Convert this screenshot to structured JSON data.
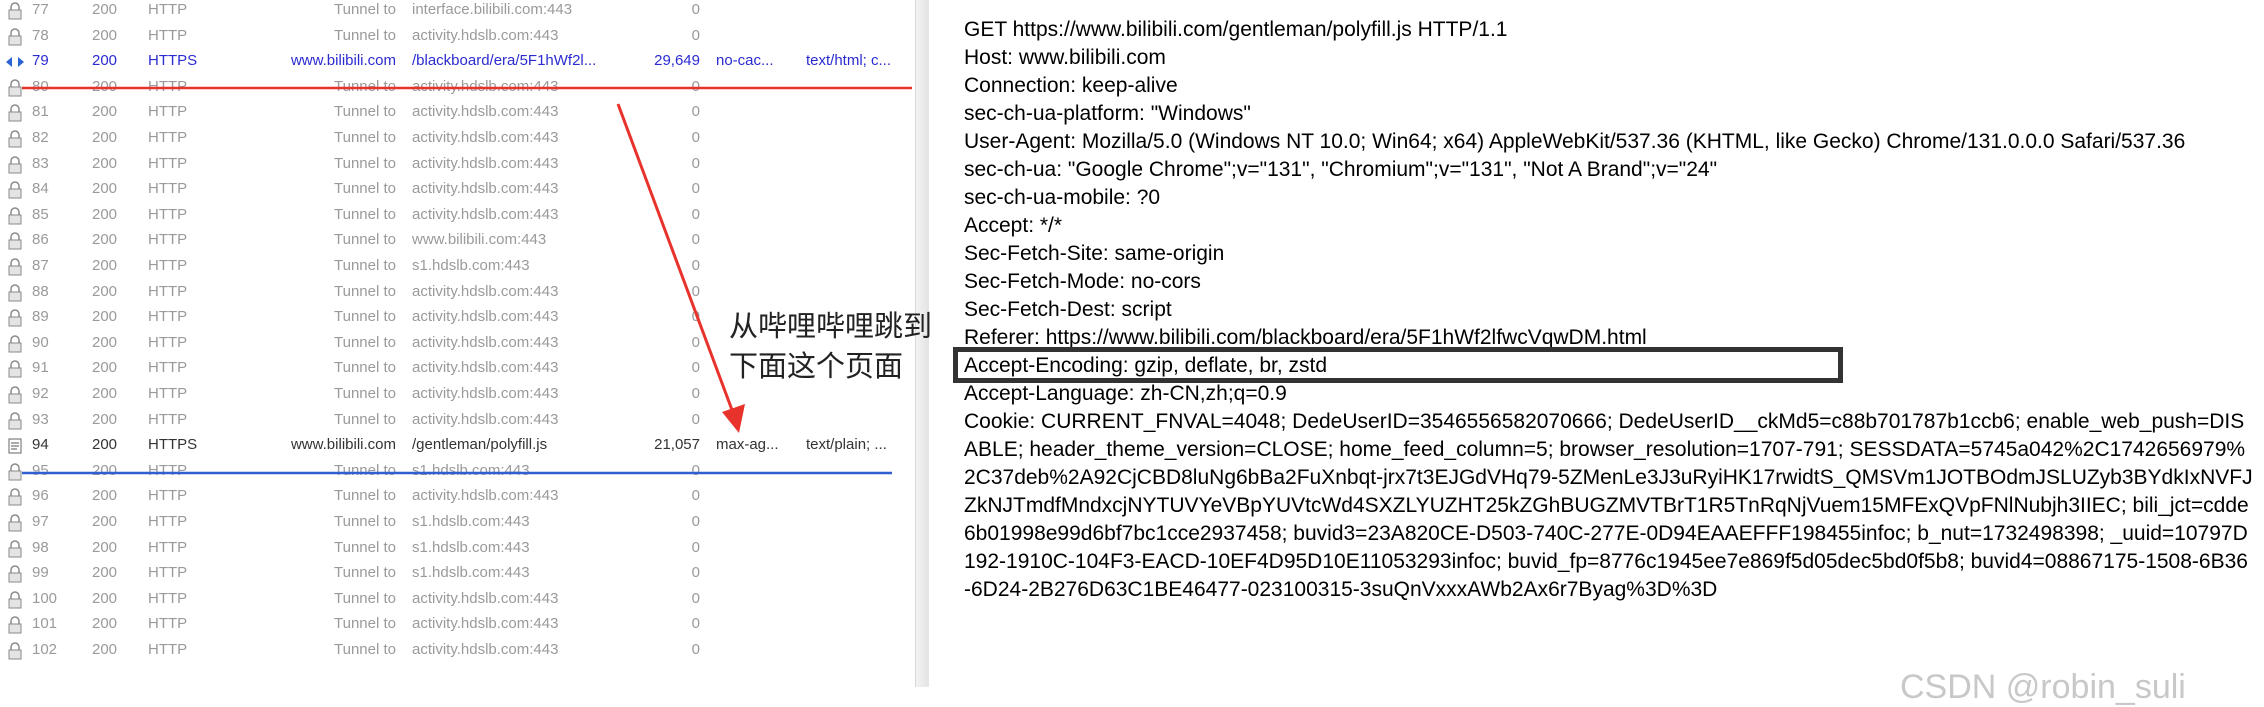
{
  "sessions": [
    {
      "num": "77",
      "result": "200",
      "protocol": "HTTP",
      "host": "Tunnel to",
      "url": "interface.bilibili.com:443",
      "body": "0",
      "kind": "tunnel"
    },
    {
      "num": "78",
      "result": "200",
      "protocol": "HTTP",
      "host": "Tunnel to",
      "url": "activity.hdslb.com:443",
      "body": "0",
      "kind": "tunnel"
    },
    {
      "num": "79",
      "result": "200",
      "protocol": "HTTPS",
      "host": "www.bilibili.com",
      "url": "/blackboard/era/5F1hWf2l...",
      "body": "29,649",
      "caching": "no-cac...",
      "content_type": "text/html; c...",
      "kind": "https-sel"
    },
    {
      "num": "80",
      "result": "200",
      "protocol": "HTTP",
      "host": "Tunnel to",
      "url": "activity.hdslb.com:443",
      "body": "0",
      "kind": "tunnel"
    },
    {
      "num": "81",
      "result": "200",
      "protocol": "HTTP",
      "host": "Tunnel to",
      "url": "activity.hdslb.com:443",
      "body": "0",
      "kind": "tunnel"
    },
    {
      "num": "82",
      "result": "200",
      "protocol": "HTTP",
      "host": "Tunnel to",
      "url": "activity.hdslb.com:443",
      "body": "0",
      "kind": "tunnel"
    },
    {
      "num": "83",
      "result": "200",
      "protocol": "HTTP",
      "host": "Tunnel to",
      "url": "activity.hdslb.com:443",
      "body": "0",
      "kind": "tunnel"
    },
    {
      "num": "84",
      "result": "200",
      "protocol": "HTTP",
      "host": "Tunnel to",
      "url": "activity.hdslb.com:443",
      "body": "0",
      "kind": "tunnel"
    },
    {
      "num": "85",
      "result": "200",
      "protocol": "HTTP",
      "host": "Tunnel to",
      "url": "activity.hdslb.com:443",
      "body": "0",
      "kind": "tunnel"
    },
    {
      "num": "86",
      "result": "200",
      "protocol": "HTTP",
      "host": "Tunnel to",
      "url": "www.bilibili.com:443",
      "body": "0",
      "kind": "tunnel"
    },
    {
      "num": "87",
      "result": "200",
      "protocol": "HTTP",
      "host": "Tunnel to",
      "url": "s1.hdslb.com:443",
      "body": "0",
      "kind": "tunnel"
    },
    {
      "num": "88",
      "result": "200",
      "protocol": "HTTP",
      "host": "Tunnel to",
      "url": "activity.hdslb.com:443",
      "body": "0",
      "kind": "tunnel"
    },
    {
      "num": "89",
      "result": "200",
      "protocol": "HTTP",
      "host": "Tunnel to",
      "url": "activity.hdslb.com:443",
      "body": "0",
      "kind": "tunnel"
    },
    {
      "num": "90",
      "result": "200",
      "protocol": "HTTP",
      "host": "Tunnel to",
      "url": "activity.hdslb.com:443",
      "body": "0",
      "kind": "tunnel"
    },
    {
      "num": "91",
      "result": "200",
      "protocol": "HTTP",
      "host": "Tunnel to",
      "url": "activity.hdslb.com:443",
      "body": "0",
      "kind": "tunnel"
    },
    {
      "num": "92",
      "result": "200",
      "protocol": "HTTP",
      "host": "Tunnel to",
      "url": "activity.hdslb.com:443",
      "body": "0",
      "kind": "tunnel"
    },
    {
      "num": "93",
      "result": "200",
      "protocol": "HTTP",
      "host": "Tunnel to",
      "url": "activity.hdslb.com:443",
      "body": "0",
      "kind": "tunnel"
    },
    {
      "num": "94",
      "result": "200",
      "protocol": "HTTPS",
      "host": "www.bilibili.com",
      "url": "/gentleman/polyfill.js",
      "body": "21,057",
      "caching": "max-ag...",
      "content_type": "text/plain; ...",
      "kind": "https"
    },
    {
      "num": "95",
      "result": "200",
      "protocol": "HTTP",
      "host": "Tunnel to",
      "url": "s1.hdslb.com:443",
      "body": "0",
      "kind": "tunnel"
    },
    {
      "num": "96",
      "result": "200",
      "protocol": "HTTP",
      "host": "Tunnel to",
      "url": "activity.hdslb.com:443",
      "body": "0",
      "kind": "tunnel"
    },
    {
      "num": "97",
      "result": "200",
      "protocol": "HTTP",
      "host": "Tunnel to",
      "url": "s1.hdslb.com:443",
      "body": "0",
      "kind": "tunnel"
    },
    {
      "num": "98",
      "result": "200",
      "protocol": "HTTP",
      "host": "Tunnel to",
      "url": "s1.hdslb.com:443",
      "body": "0",
      "kind": "tunnel"
    },
    {
      "num": "99",
      "result": "200",
      "protocol": "HTTP",
      "host": "Tunnel to",
      "url": "s1.hdslb.com:443",
      "body": "0",
      "kind": "tunnel"
    },
    {
      "num": "100",
      "result": "200",
      "protocol": "HTTP",
      "host": "Tunnel to",
      "url": "activity.hdslb.com:443",
      "body": "0",
      "kind": "tunnel"
    },
    {
      "num": "101",
      "result": "200",
      "protocol": "HTTP",
      "host": "Tunnel to",
      "url": "activity.hdslb.com:443",
      "body": "0",
      "kind": "tunnel"
    },
    {
      "num": "102",
      "result": "200",
      "protocol": "HTTP",
      "host": "Tunnel to",
      "url": "activity.hdslb.com:443",
      "body": "0",
      "kind": "tunnel"
    }
  ],
  "request_lines": [
    "GET https://www.bilibili.com/gentleman/polyfill.js HTTP/1.1",
    "Host: www.bilibili.com",
    "Connection: keep-alive",
    "sec-ch-ua-platform: \"Windows\"",
    "User-Agent: Mozilla/5.0 (Windows NT 10.0; Win64; x64) AppleWebKit/537.36 (KHTML, like Gecko) Chrome/131.0.0.0 Safari/537.36",
    "sec-ch-ua: \"Google Chrome\";v=\"131\", \"Chromium\";v=\"131\", \"Not A Brand\";v=\"24\"",
    "sec-ch-ua-mobile: ?0",
    "Accept: */*",
    "Sec-Fetch-Site: same-origin",
    "Sec-Fetch-Mode: no-cors",
    "Sec-Fetch-Dest: script",
    "Referer: https://www.bilibili.com/blackboard/era/5F1hWf2lfwcVqwDM.html",
    "Accept-Encoding: gzip, deflate, br, zstd",
    "Accept-Language: zh-CN,zh;q=0.9",
    "Cookie: CURRENT_FNVAL=4048; DedeUserID=3546556582070666; DedeUserID__ckMd5=c88b701787b1ccb6; enable_web_push=DISABLE; header_theme_version=CLOSE; home_feed_column=5; browser_resolution=1707-791; SESSDATA=5745a042%2C1742656979%2C37deb%2A92CjCBD8luNg6bBa2FuXnbqt-jrx7t3EJGdVHq79-5ZMenLe3J3uRyiHK17rwidtS_QMSVm1JOTBOdmJSLUZyb3BYdkIxNVFJZkNJTmdfMndxcjNYTUVYeVBpYUVtcWd4SXZLYUZHT25kZGhBUGZMVTBrT1R5TnRqNjVuem15MFExQVpFNlNubjh3IIEC; bili_jct=cdde6b01998e99d6bf7bc1cce2937458; buvid3=23A820CE-D503-740C-277E-0D94EAAEFFF198455infoc; b_nut=1732498398; _uuid=10797D192-1910C-104F3-EACD-10EF4D95D10E11053293infoc; buvid_fp=8776c1945ee7e869f5d05dec5bd0f5b8; buvid4=08867175-1508-6B36-6D24-2B276D63C1BE46477-023100315-3suQnVxxxAWb2Ax6r7Byag%3D%3D"
  ],
  "annotation": {
    "line1": "从哔哩哔哩跳到",
    "line2": "下面这个页面"
  },
  "watermark": "CSDN @robin_suli",
  "colors": {
    "red_mark": "#e8322c",
    "blue_mark": "#2f5fd0",
    "box": "#333333"
  }
}
